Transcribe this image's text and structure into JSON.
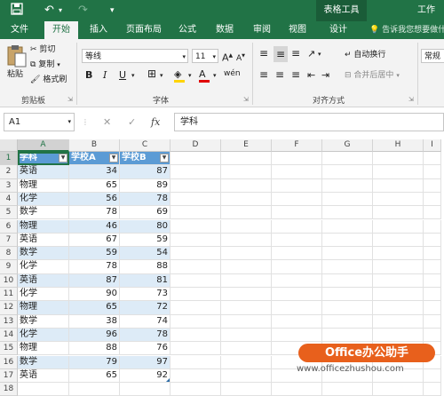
{
  "titlebar": {
    "save_icon": "save-icon",
    "undo_icon": "undo-icon",
    "redo_icon": "redo-icon",
    "customize_icon": "customize-qat-icon",
    "context_tools": "表格工具",
    "app_title": "工作"
  },
  "tabs": [
    {
      "label": "文件"
    },
    {
      "label": "开始"
    },
    {
      "label": "插入"
    },
    {
      "label": "页面布局"
    },
    {
      "label": "公式"
    },
    {
      "label": "数据"
    },
    {
      "label": "审阅"
    },
    {
      "label": "视图"
    },
    {
      "label": "设计"
    }
  ],
  "tell_me": "告诉我您想要做什么",
  "ribbon": {
    "clipboard": {
      "paste": "粘贴",
      "cut": "剪切",
      "copy": "复制",
      "format_painter": "格式刷",
      "group_label": "剪贴板"
    },
    "font": {
      "font_name": "等线",
      "font_size": "11",
      "bold": "B",
      "italic": "I",
      "underline": "U",
      "grow": "A",
      "shrink": "A",
      "font_color_letter": "A",
      "phonetic": "wén",
      "group_label": "字体"
    },
    "alignment": {
      "wrap_text": "自动换行",
      "merge_center": "合并后居中",
      "group_label": "对齐方式"
    },
    "number": {
      "format": "常规"
    }
  },
  "formula_bar": {
    "name_box": "A1",
    "cancel": "✕",
    "enter": "✓",
    "fx": "fx",
    "content": "学科"
  },
  "grid": {
    "columns": [
      "A",
      "B",
      "C",
      "D",
      "E",
      "F",
      "G",
      "H",
      "I"
    ],
    "rows": [
      "1",
      "2",
      "3",
      "4",
      "5",
      "6",
      "7",
      "8",
      "9",
      "10",
      "11",
      "12",
      "13",
      "14",
      "15",
      "16",
      "17",
      "18"
    ],
    "header": [
      "学科",
      "学校A",
      "学校B"
    ],
    "data": [
      [
        "英语",
        "34",
        "87"
      ],
      [
        "物理",
        "65",
        "89"
      ],
      [
        "化学",
        "56",
        "78"
      ],
      [
        "数学",
        "78",
        "69"
      ],
      [
        "物理",
        "46",
        "80"
      ],
      [
        "英语",
        "67",
        "59"
      ],
      [
        "数学",
        "59",
        "54"
      ],
      [
        "化学",
        "78",
        "88"
      ],
      [
        "英语",
        "87",
        "81"
      ],
      [
        "化学",
        "90",
        "73"
      ],
      [
        "物理",
        "65",
        "72"
      ],
      [
        "数学",
        "38",
        "74"
      ],
      [
        "化学",
        "96",
        "78"
      ],
      [
        "物理",
        "88",
        "76"
      ],
      [
        "数学",
        "79",
        "97"
      ],
      [
        "英语",
        "65",
        "92"
      ]
    ]
  },
  "watermark": {
    "text": "Office办公助手",
    "url": "www.officezhushou.com"
  },
  "colors": {
    "excel_green": "#217346",
    "table_header": "#5b9bd5",
    "table_band": "#ddebf7",
    "watermark_orange": "#e8601c"
  }
}
